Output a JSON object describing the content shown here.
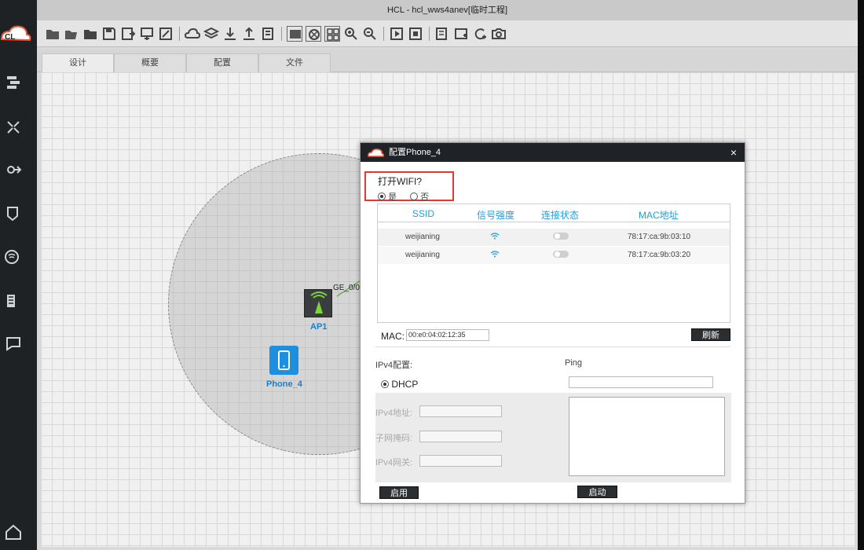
{
  "window": {
    "title": "HCL - hcl_wws4anev[临时工程]"
  },
  "app": {
    "logo_text": "CL"
  },
  "tabs": [
    "设计",
    "概要",
    "配置",
    "文件"
  ],
  "toolbar_icons": [
    "new-project-icon",
    "open-project-icon",
    "open-folder-icon",
    "save-icon",
    "save-as-icon",
    "export-icon",
    "edit-icon",
    "cloud-icon",
    "layers-icon",
    "download-icon",
    "upload-icon",
    "list-icon",
    "capture-icon",
    "network-icon",
    "grid-icon",
    "zoom-in-icon",
    "zoom-out-icon",
    "play-icon",
    "stop-icon",
    "log-icon",
    "add-window-icon",
    "refresh-add-icon",
    "camera-icon"
  ],
  "sidebar_icons": [
    "switch-device-icon",
    "router-device-icon",
    "server-device-icon",
    "security-device-icon",
    "wireless-device-icon",
    "rack-device-icon",
    "terminal-device-icon",
    "home-icon"
  ],
  "topology": {
    "ap_label": "AP1",
    "phone_label": "Phone_4",
    "link_label": "GE_0/0"
  },
  "dialog": {
    "title": "配置Phone_4",
    "close": "×",
    "wifi_question": "打开WIFI?",
    "wifi_yes": "是",
    "wifi_no": "否",
    "columns": [
      "SSID",
      "信号强度",
      "连接状态",
      "MAC地址"
    ],
    "networks": [
      {
        "ssid": "weijianing",
        "mac": "78:17:ca:9b:03:10"
      },
      {
        "ssid": "weijianing",
        "mac": "78:17:ca:9b:03:20"
      }
    ],
    "mac_label": "MAC:",
    "mac_value": "00:e0:04:02:12:35",
    "refresh_button": "刷新",
    "ipv4_section": "IPv4配置:",
    "dhcp_label": "DHCP",
    "ipv4_address_label": "IPv4地址:",
    "subnet_mask_label": "子网掩码:",
    "gateway_label": "IPv4网关:",
    "apply_button": "启用",
    "ping_label": "Ping",
    "ping_start_button": "启动"
  },
  "colors": {
    "accent": "#1b9fe0",
    "highlight": "#e33333",
    "dark": "#1f2226"
  }
}
